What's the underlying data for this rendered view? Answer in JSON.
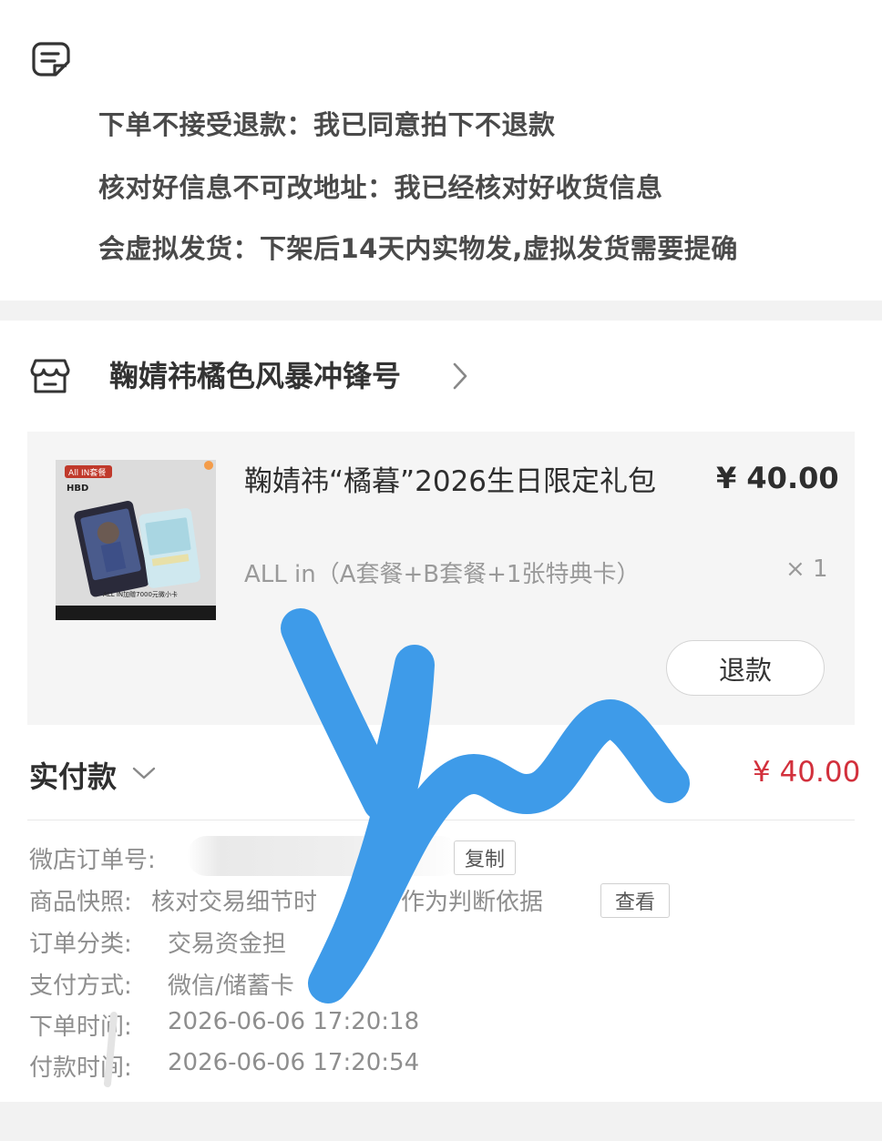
{
  "notes": {
    "line1": "下单不接受退款：我已同意拍下不退款",
    "line2": "核对好信息不可改地址：我已经核对好收货信息",
    "line3": "会虚拟发货：下架后14天内实物发,虚拟发货需要提确",
    "icon": "note-icon"
  },
  "shop": {
    "name": "鞠婧祎橘色风暴冲锋号",
    "icon": "shop-icon"
  },
  "product": {
    "title": "鞠婧祎“橘暮”2026生日限定礼包",
    "price": "¥ 40.00",
    "variant": "ALL in（A套餐+B套餐+1张特典卡）",
    "quantity": "× 1",
    "refund_label": "退款",
    "thumb": {
      "badge": "All IN套餐",
      "hbd": "HBD",
      "caption": "ALL IN加赠7000元微小卡"
    }
  },
  "payment": {
    "label": "实付款",
    "amount": "¥ 40.00"
  },
  "order": {
    "order_no_label": "微店订单号:",
    "copy_label": "复制",
    "snapshot_label": "商品快照:",
    "snapshot_value": "核对交易细节时",
    "snapshot_value_tail": "作为判断依据",
    "view_label": "查看",
    "category_label": "订单分类:",
    "category_value": "交易资金担",
    "pay_method_label": "支付方式:",
    "pay_method_value": "微信/储蓄卡",
    "order_time_label": "下单时间:",
    "order_time_value": "2026-06-06 17:20:18",
    "pay_time_label": "付款时间:",
    "pay_time_value": "2026-06-06 17:20:54"
  },
  "colors": {
    "price_red": "#d2303c",
    "scribble_blue": "#3e9be9"
  }
}
